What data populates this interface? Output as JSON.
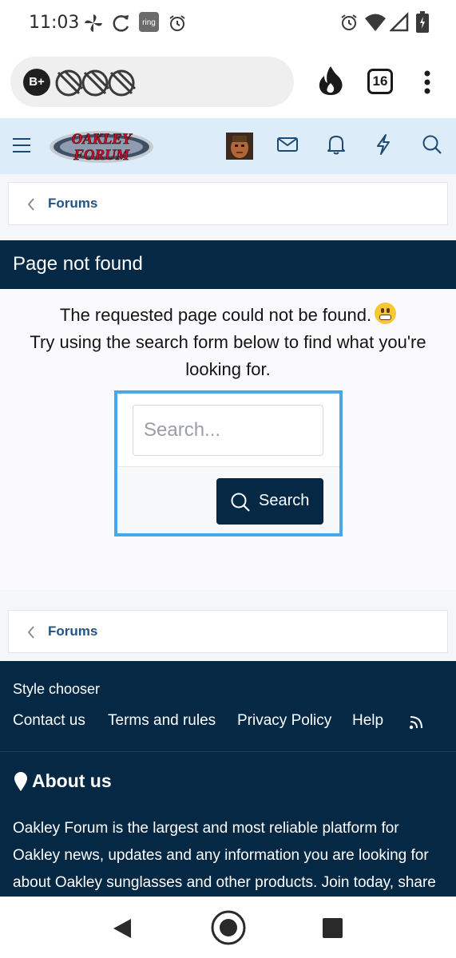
{
  "status_bar": {
    "time": "11:03",
    "left_icons": [
      "pinwheel-icon",
      "sync-icon",
      "ring-app-icon",
      "alarm-icon"
    ],
    "ring_label": "ring",
    "right_icons": [
      "alarm-icon",
      "wifi-icon",
      "cell-signal-icon",
      "battery-charging-icon"
    ]
  },
  "browser": {
    "badge": "B+",
    "tab_count": "16",
    "icons": [
      "fire-icon",
      "menu-kebab-icon"
    ]
  },
  "header": {
    "logo_line1": "OAKLEY",
    "logo_line2": "FORUM",
    "icons": [
      "hamburger-menu-icon",
      "avatar",
      "envelope-icon",
      "bell-icon",
      "bolt-icon",
      "search-icon"
    ]
  },
  "breadcrumb_top": {
    "label": "Forums"
  },
  "page": {
    "title": "Page not found",
    "message_line1": "The requested page could not be found.",
    "message_line2": "Try using the search form below to find what you're looking for."
  },
  "search": {
    "placeholder": "Search...",
    "button_label": "Search"
  },
  "breadcrumb_bottom": {
    "label": "Forums"
  },
  "footer": {
    "style_chooser": "Style chooser",
    "links": [
      "Contact us",
      "Terms and rules",
      "Privacy Policy",
      "Help"
    ],
    "about_title": "About us",
    "about_text": "Oakley Forum is the largest and most reliable platform for Oakley news, updates and any information you are looking for about Oakley sunglasses and other products. Join today, share"
  },
  "colors": {
    "header_bg": "#dcecf9",
    "dark_navy": "#052845",
    "link_blue": "#225586",
    "search_focus_border": "#47a7eb"
  }
}
